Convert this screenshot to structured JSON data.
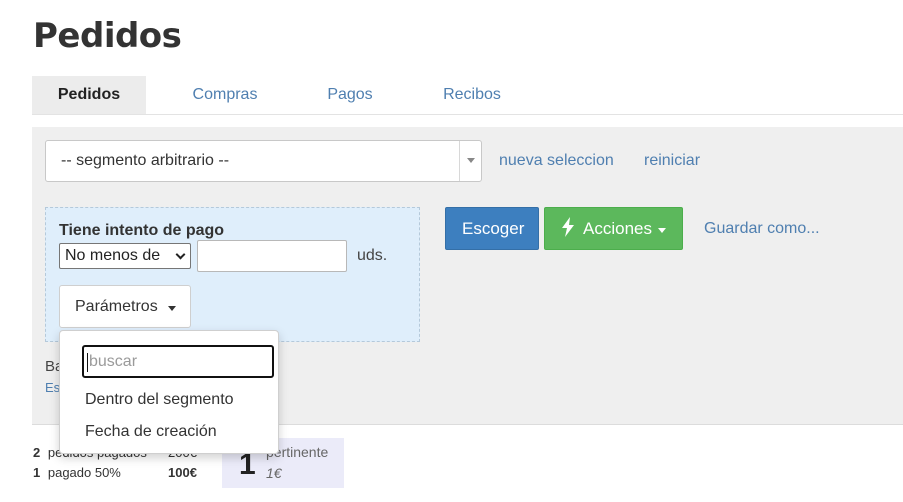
{
  "page": {
    "title": "Pedidos"
  },
  "tabs": [
    {
      "label": "Pedidos",
      "active": true
    },
    {
      "label": "Compras",
      "active": false
    },
    {
      "label": "Pagos",
      "active": false
    },
    {
      "label": "Recibos",
      "active": false
    }
  ],
  "segment": {
    "selected": "-- segmento arbitrario --",
    "new_selection_link": "nueva seleccion",
    "reset_link": "reiniciar"
  },
  "filter": {
    "title": "Tiene intento de pago",
    "operator": "No menos de",
    "value": "",
    "unit": "uds.",
    "params_button": "Parámetros"
  },
  "actions": {
    "choose_button": "Escoger",
    "actions_button": "Acciones",
    "save_as_link": "Guardar como..."
  },
  "behind_dropdown": {
    "line1": "Ba",
    "line2": "Es"
  },
  "params_dropdown": {
    "search_placeholder": "buscar",
    "items": [
      "Dentro del segmento",
      "Fecha de creación"
    ]
  },
  "stats": {
    "row1": {
      "count": "2",
      "label": "pedidos pagados",
      "amount": "200€"
    },
    "row2": {
      "count": "1",
      "label": "pagado 50%",
      "amount": "100€"
    }
  },
  "pertinent": {
    "count": "1",
    "label": "pertinente",
    "value": "1€"
  },
  "colors": {
    "link": "#4f7fb0",
    "primary": "#3d7fbf",
    "success": "#5cb85c",
    "filter_bg": "#dfeefb",
    "panel_bg": "#efefef"
  }
}
